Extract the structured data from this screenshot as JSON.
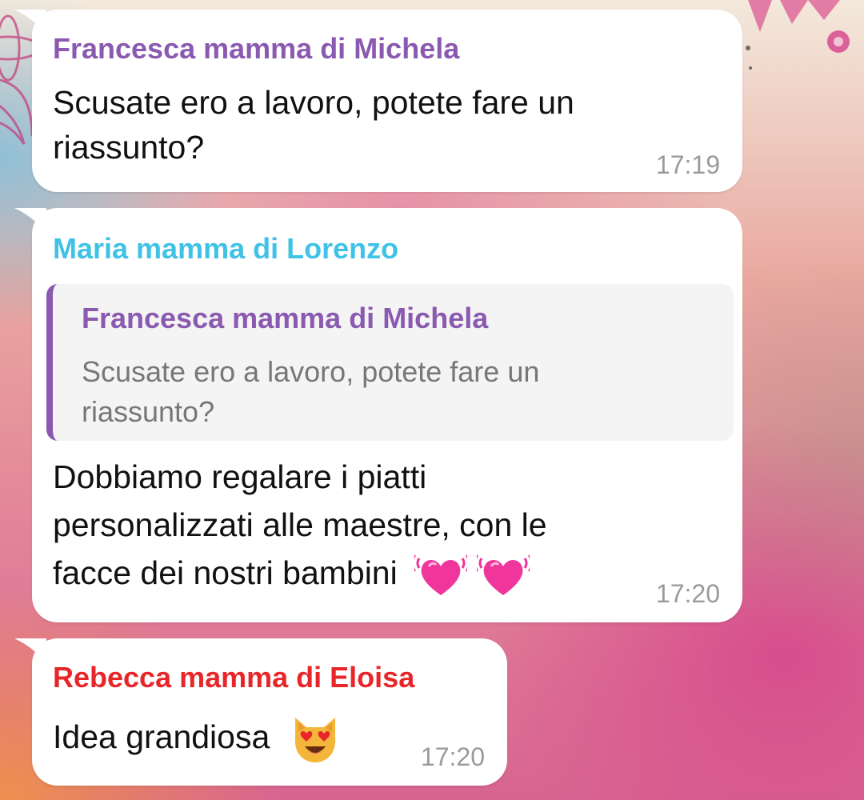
{
  "messages": [
    {
      "sender": "Francesca mamma di Michela",
      "sender_color": "#8a59b0",
      "lines": [
        "Scusate ero a lavoro, potete fare un",
        "riassunto?"
      ],
      "time": "17:19"
    },
    {
      "sender": "Maria mamma di Lorenzo",
      "sender_color": "#3fc2e6",
      "reply": {
        "sender": "Francesca mamma di Michela",
        "lines": [
          "Scusate ero a lavoro, potete fare un",
          "riassunto?"
        ]
      },
      "lines": [
        "Dobbiamo regalare i piatti",
        "personalizzati alle maestre, con le",
        "facce dei nostri bambini"
      ],
      "emojis": [
        "beating-heart-emoji",
        "beating-heart-emoji"
      ],
      "time": "17:20"
    },
    {
      "sender": "Rebecca mamma di Eloisa",
      "sender_color": "#e8262a",
      "lines": [
        "Idea grandiosa"
      ],
      "emojis": [
        "heart-eyes-cat-emoji"
      ],
      "time": "17:20"
    }
  ]
}
